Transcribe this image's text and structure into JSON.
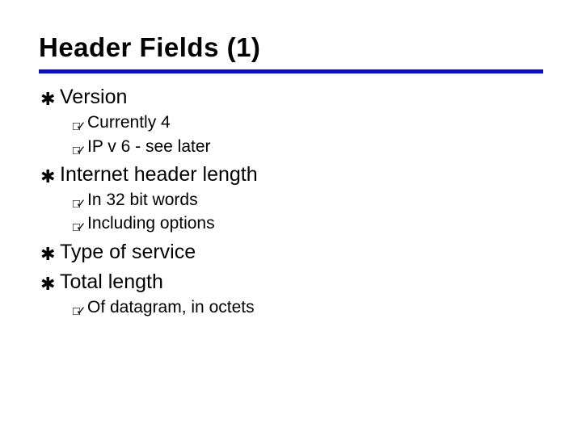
{
  "title": "Header Fields (1)",
  "bullets": {
    "b0": {
      "text": "Version"
    },
    "b1": {
      "text": "Internet header length"
    },
    "b2": {
      "text": "Type of service"
    },
    "b3": {
      "text": "Total length"
    }
  },
  "subs": {
    "s0a": "Currently 4",
    "s0b": "IP v 6 - see later",
    "s1a": "In 32 bit words",
    "s1b": "Including options",
    "s3a": "Of datagram, in octets"
  },
  "glyphs": {
    "z": "✱",
    "y": "□✓"
  }
}
